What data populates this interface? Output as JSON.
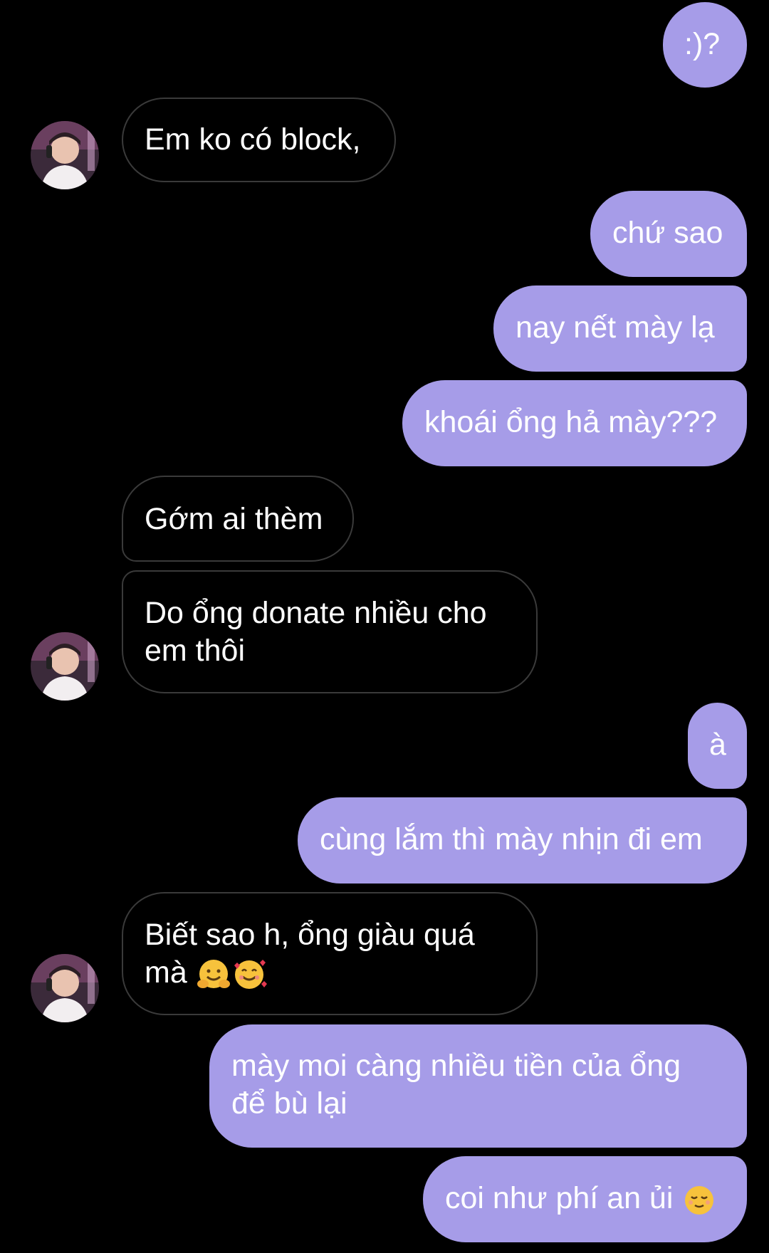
{
  "conversation": {
    "messages": [
      {
        "side": "out",
        "text": ":)?"
      },
      {
        "side": "in",
        "text": "Em ko có block,"
      },
      {
        "side": "out",
        "text": "chứ sao"
      },
      {
        "side": "out",
        "text": "nay nết mày lạ"
      },
      {
        "side": "out",
        "text": "khoái ổng hả mày???"
      },
      {
        "side": "in",
        "text": "Gớm ai thèm"
      },
      {
        "side": "in",
        "text": "Do ổng donate nhiều cho\nem thôi"
      },
      {
        "side": "out",
        "text": "à"
      },
      {
        "side": "out",
        "text": "cùng lắm thì mày nhịn đi em"
      },
      {
        "side": "in",
        "text": "Biết sao h, ổng giàu quá\nmà",
        "emojis": [
          "hugging-face",
          "smiling-face-with-hearts"
        ]
      },
      {
        "side": "out",
        "text": "mày moi càng nhiều tiền của ổng\nđể bù lại"
      },
      {
        "side": "out",
        "text": "coi như phí an ủi",
        "emojis": [
          "relieved-face"
        ]
      }
    ]
  },
  "theme": {
    "background": "#000000",
    "outgoing_bubble": "#a69ce8",
    "incoming_bubble_border": "#3a3a3a",
    "text": "#ffffff"
  }
}
